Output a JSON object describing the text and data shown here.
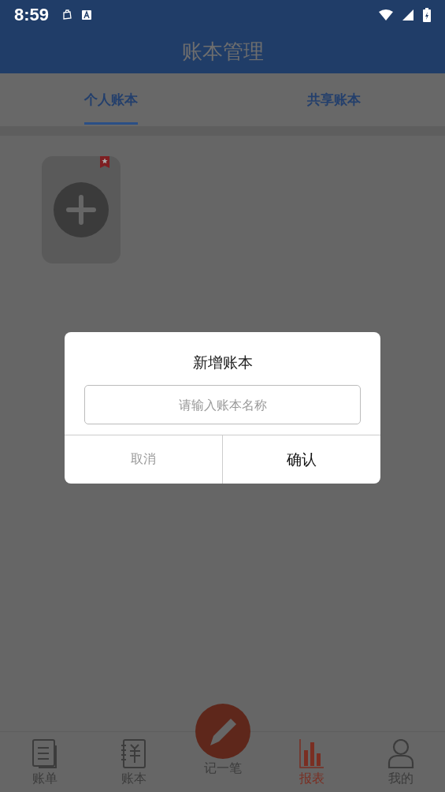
{
  "status_bar": {
    "time": "8:59"
  },
  "app_bar": {
    "title": "账本管理"
  },
  "tabs": [
    {
      "label": "个人账本",
      "selected": true
    },
    {
      "label": "共享账本",
      "selected": false
    }
  ],
  "dialog": {
    "title": "新增账本",
    "field": {
      "placeholder": "请输入账本名称"
    },
    "cancel": "取消",
    "confirm": "确认"
  },
  "bottom_nav": [
    {
      "kind": "bill",
      "label": "账单",
      "selected": false
    },
    {
      "kind": "book",
      "label": "账本",
      "selected": false
    },
    {
      "kind": "record",
      "label": "记一笔",
      "selected": false
    },
    {
      "kind": "report",
      "label": "报表",
      "selected": true
    },
    {
      "kind": "profile",
      "label": "我的",
      "selected": false
    }
  ]
}
